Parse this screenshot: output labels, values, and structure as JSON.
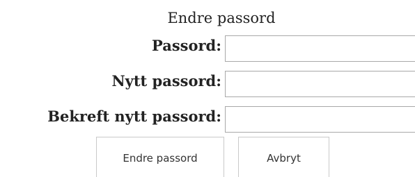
{
  "form": {
    "title": "Endre passord",
    "fields": [
      {
        "label": "Passord:",
        "value": "",
        "placeholder": ""
      },
      {
        "label": "Nytt passord:",
        "value": "",
        "placeholder": ""
      },
      {
        "label": "Bekreft nytt passord:",
        "value": "",
        "placeholder": ""
      }
    ],
    "buttons": {
      "submit_label": "Endre passord",
      "cancel_label": "Avbryt"
    }
  },
  "colors": {
    "background": "#ffffff",
    "text": "#222222",
    "input_border": "#a8a8a8",
    "button_border": "#c9c9c9"
  }
}
